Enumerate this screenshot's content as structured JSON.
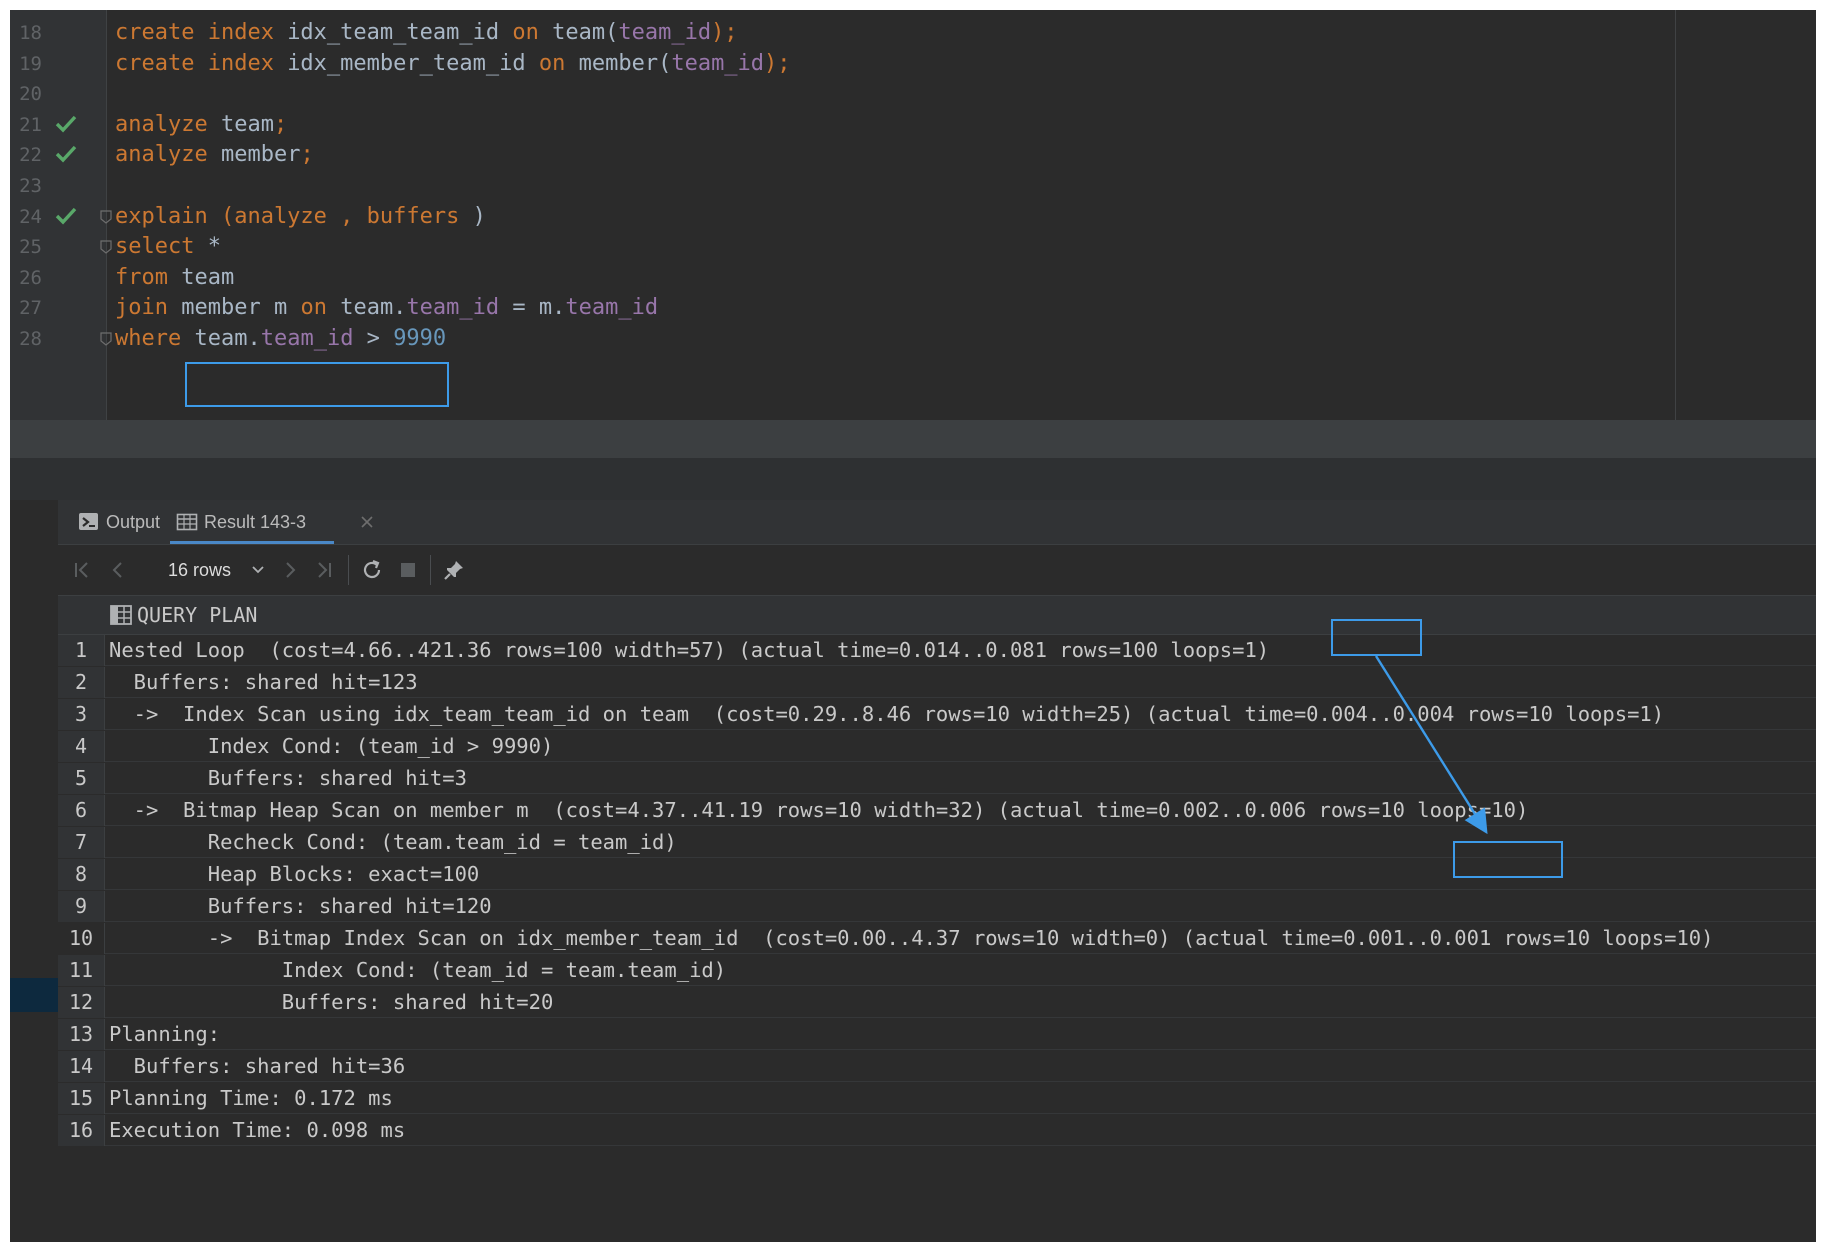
{
  "editor": {
    "lines": [
      {
        "num": "18",
        "check": false,
        "fold": false,
        "tokens": [
          {
            "t": "create index ",
            "c": "kw"
          },
          {
            "t": "idx_team_team_id ",
            "c": "txt"
          },
          {
            "t": "on ",
            "c": "kw"
          },
          {
            "t": "team(",
            "c": "txt"
          },
          {
            "t": "team_id",
            "c": "col"
          },
          {
            "t": ");",
            "c": "kw"
          }
        ]
      },
      {
        "num": "19",
        "check": false,
        "fold": false,
        "tokens": [
          {
            "t": "create index ",
            "c": "kw"
          },
          {
            "t": "idx_member_team_id ",
            "c": "txt"
          },
          {
            "t": "on ",
            "c": "kw"
          },
          {
            "t": "member(",
            "c": "txt"
          },
          {
            "t": "team_id",
            "c": "col"
          },
          {
            "t": ");",
            "c": "kw"
          }
        ]
      },
      {
        "num": "20",
        "check": false,
        "fold": false,
        "tokens": []
      },
      {
        "num": "21",
        "check": true,
        "fold": false,
        "tokens": [
          {
            "t": "analyze ",
            "c": "kw"
          },
          {
            "t": "team",
            "c": "txt"
          },
          {
            "t": ";",
            "c": "kw"
          }
        ]
      },
      {
        "num": "22",
        "check": true,
        "fold": false,
        "tokens": [
          {
            "t": "analyze ",
            "c": "kw"
          },
          {
            "t": "member",
            "c": "txt"
          },
          {
            "t": ";",
            "c": "kw"
          }
        ]
      },
      {
        "num": "23",
        "check": false,
        "fold": false,
        "tokens": []
      },
      {
        "num": "24",
        "check": true,
        "fold": true,
        "tokens": [
          {
            "t": "explain (analyze , buffers ",
            "c": "kw"
          },
          {
            "t": ")",
            "c": "txt"
          }
        ]
      },
      {
        "num": "25",
        "check": false,
        "fold": true,
        "tokens": [
          {
            "t": "select ",
            "c": "kw"
          },
          {
            "t": "*",
            "c": "txt"
          }
        ]
      },
      {
        "num": "26",
        "check": false,
        "fold": false,
        "tokens": [
          {
            "t": "from ",
            "c": "kw"
          },
          {
            "t": "team",
            "c": "txt"
          }
        ]
      },
      {
        "num": "27",
        "check": false,
        "fold": false,
        "tokens": [
          {
            "t": "join ",
            "c": "kw"
          },
          {
            "t": "member m ",
            "c": "txt"
          },
          {
            "t": "on ",
            "c": "kw"
          },
          {
            "t": "team.",
            "c": "txt"
          },
          {
            "t": "team_id",
            "c": "col"
          },
          {
            "t": " = m.",
            "c": "txt"
          },
          {
            "t": "team_id",
            "c": "col"
          }
        ]
      },
      {
        "num": "28",
        "check": false,
        "fold": true,
        "tokens": [
          {
            "t": "where ",
            "c": "kw"
          },
          {
            "t": "team.",
            "c": "txt"
          },
          {
            "t": "team_id",
            "c": "col"
          },
          {
            "t": " > ",
            "c": "txt"
          },
          {
            "t": "9990",
            "c": "num"
          }
        ]
      }
    ]
  },
  "tabs": {
    "output_label": "Output",
    "result_label": "Result 143-3"
  },
  "toolbar": {
    "rows_label": "16 rows"
  },
  "grid": {
    "column_header": "QUERY PLAN",
    "selected_row": "10",
    "rows": [
      {
        "n": "1",
        "text": "Nested Loop  (cost=4.66..421.36 rows=100 width=57) (actual time=0.014..0.081 rows=100 loops=1)"
      },
      {
        "n": "2",
        "text": "  Buffers: shared hit=123"
      },
      {
        "n": "3",
        "text": "  ->  Index Scan using idx_team_team_id on team  (cost=0.29..8.46 rows=10 width=25) (actual time=0.004..0.004 rows=10 loops=1)"
      },
      {
        "n": "4",
        "text": "        Index Cond: (team_id > 9990)"
      },
      {
        "n": "5",
        "text": "        Buffers: shared hit=3"
      },
      {
        "n": "6",
        "text": "  ->  Bitmap Heap Scan on member m  (cost=4.37..41.19 rows=10 width=32) (actual time=0.002..0.006 rows=10 loops=10)"
      },
      {
        "n": "7",
        "text": "        Recheck Cond: (team.team_id = team_id)"
      },
      {
        "n": "8",
        "text": "        Heap Blocks: exact=100"
      },
      {
        "n": "9",
        "text": "        Buffers: shared hit=120"
      },
      {
        "n": "10",
        "text": "        ->  Bitmap Index Scan on idx_member_team_id  (cost=0.00..4.37 rows=10 width=0) (actual time=0.001..0.001 rows=10 loops=10)"
      },
      {
        "n": "11",
        "text": "              Index Cond: (team_id = team.team_id)"
      },
      {
        "n": "12",
        "text": "              Buffers: shared hit=20"
      },
      {
        "n": "13",
        "text": "Planning:"
      },
      {
        "n": "14",
        "text": "  Buffers: shared hit=36"
      },
      {
        "n": "15",
        "text": "Planning Time: 0.172 ms"
      },
      {
        "n": "16",
        "text": "Execution Time: 0.098 ms"
      }
    ]
  },
  "colors": {
    "keyword": "#cc7832",
    "column": "#9876aa",
    "number": "#6897bb",
    "text": "#a9b7c6",
    "highlight_box": "#3d9be9",
    "check": "#59a869"
  },
  "icons": {
    "check": "check-icon",
    "output": "console-icon",
    "result": "table-icon",
    "first": "first-page-icon",
    "prev": "prev-page-icon",
    "next": "next-page-icon",
    "last": "last-page-icon",
    "reload": "reload-icon",
    "stop": "stop-icon",
    "pin": "pin-icon"
  }
}
